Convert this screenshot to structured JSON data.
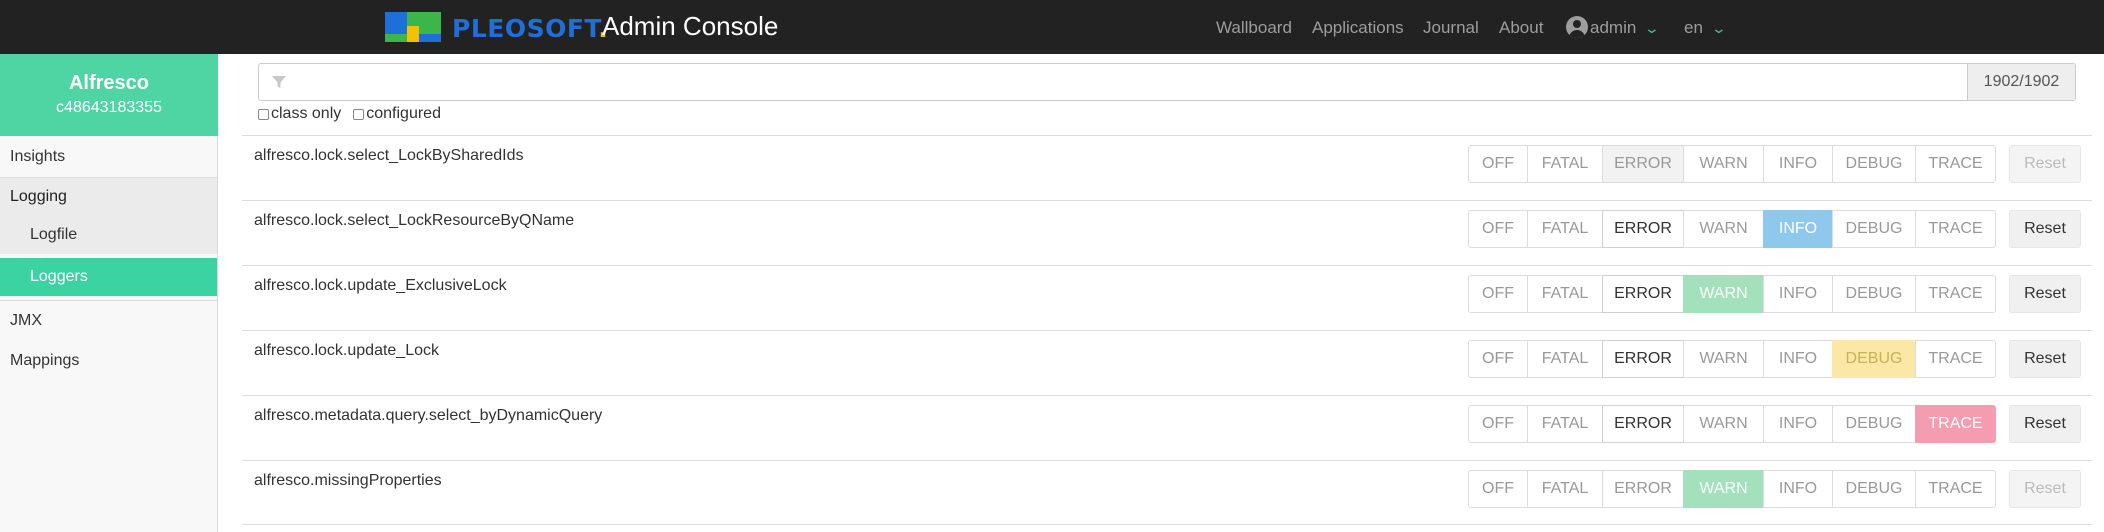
{
  "header": {
    "brand": "PLEOSOFT",
    "brand_dot": ".",
    "title": "Admin Console",
    "nav": [
      "Wallboard",
      "Applications",
      "Journal",
      "About"
    ],
    "user": "admin",
    "language": "en",
    "logo_colors": [
      "#1e6fd9",
      "#3cb54a",
      "#f2c200"
    ]
  },
  "sidebar": {
    "app_name": "Alfresco",
    "app_id": "c48643183355",
    "items": {
      "insights": "Insights",
      "logging": "Logging",
      "logfile": "Logfile",
      "loggers": "Loggers",
      "jmx": "JMX",
      "mappings": "Mappings"
    },
    "accent_color": "#4fd5a4"
  },
  "filter": {
    "placeholder": "",
    "count": "1902/1902",
    "class_only": "class only",
    "configured": "configured"
  },
  "levels": [
    "OFF",
    "FATAL",
    "ERROR",
    "WARN",
    "INFO",
    "DEBUG",
    "TRACE"
  ],
  "reset_label": "Reset",
  "loggers": [
    {
      "name": "alfresco.lock.select_LockBySharedIds",
      "state": "ERROR inherited",
      "reset_enabled": false
    },
    {
      "name": "alfresco.lock.select_LockResourceByQName",
      "state": "INFO",
      "reset_enabled": true
    },
    {
      "name": "alfresco.lock.update_ExclusiveLock",
      "state": "WARN",
      "reset_enabled": true
    },
    {
      "name": "alfresco.lock.update_Lock",
      "state": "DEBUG",
      "reset_enabled": true
    },
    {
      "name": "alfresco.metadata.query.select_byDynamicQuery",
      "state": "TRACE",
      "reset_enabled": true
    },
    {
      "name": "alfresco.missingProperties",
      "state": "WARN inherited",
      "reset_enabled": false
    }
  ]
}
